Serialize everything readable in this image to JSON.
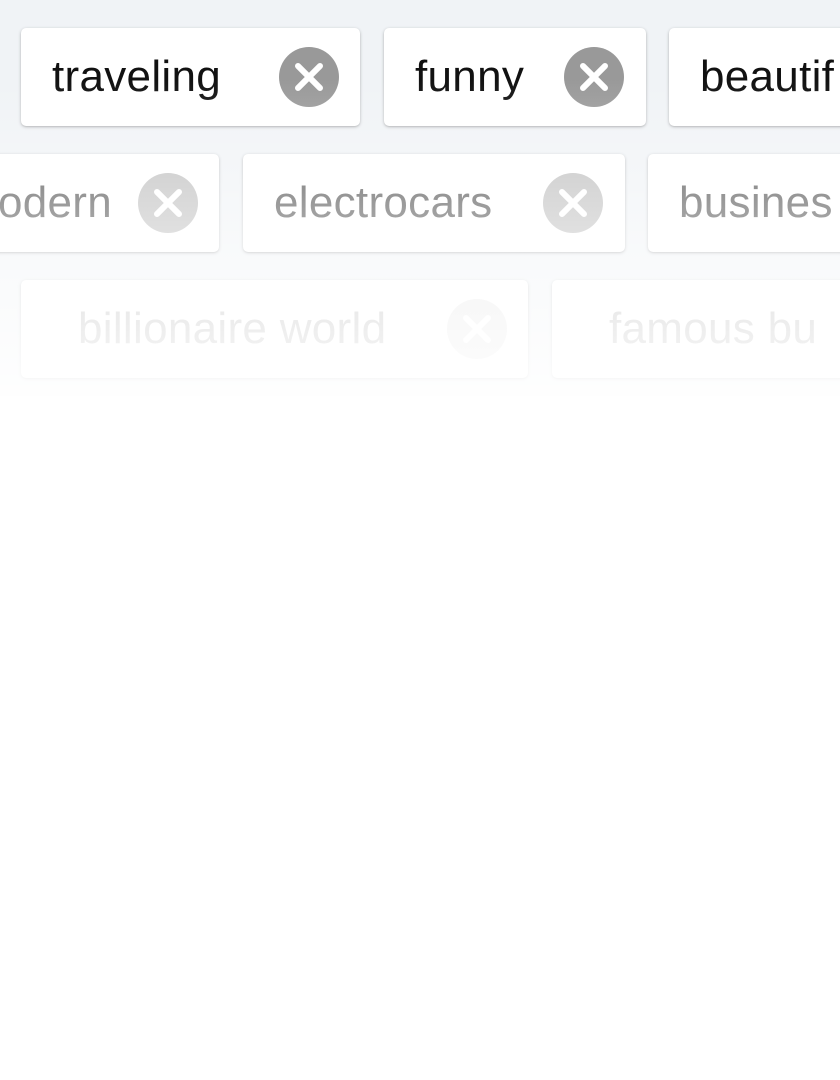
{
  "tags": {
    "rows": [
      [
        {
          "label": "traveling"
        },
        {
          "label": "funny"
        },
        {
          "label": "beautif"
        }
      ],
      [
        {
          "label": "odern"
        },
        {
          "label": "electrocars"
        },
        {
          "label": "busines"
        }
      ],
      [
        {
          "label": "billionaire world"
        },
        {
          "label": "famous bu"
        }
      ]
    ]
  },
  "colors": {
    "background": "#f0f3f6",
    "chip": "#ffffff",
    "remove_row1": "#999999",
    "remove_row2": "#c0c0c0",
    "remove_row3": "#e8e8e8"
  },
  "icons": {
    "remove": "close-icon"
  }
}
